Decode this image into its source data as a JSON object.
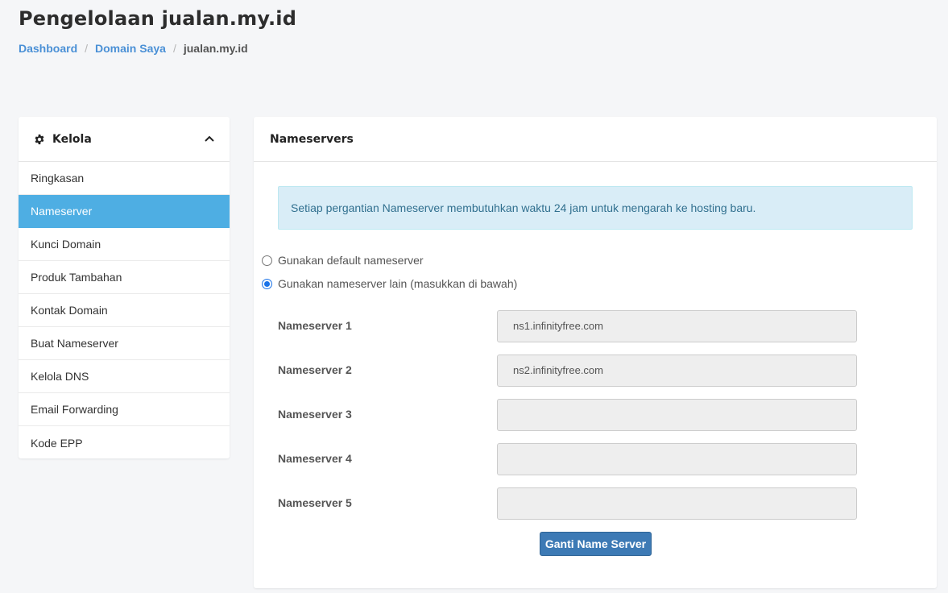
{
  "page": {
    "title": "Pengelolaan jualan.my.id"
  },
  "breadcrumb": [
    {
      "label": "Dashboard"
    },
    {
      "label": "Domain Saya"
    },
    {
      "label": "jualan.my.id"
    }
  ],
  "sidebar": {
    "title": "Kelola",
    "icon": "gear-icon",
    "collapse_icon": "chevron-up-icon",
    "items": [
      {
        "label": "Ringkasan",
        "active": false
      },
      {
        "label": "Nameserver",
        "active": true
      },
      {
        "label": "Kunci Domain",
        "active": false
      },
      {
        "label": "Produk Tambahan",
        "active": false
      },
      {
        "label": "Kontak Domain",
        "active": false
      },
      {
        "label": "Buat Nameserver",
        "active": false
      },
      {
        "label": "Kelola DNS",
        "active": false
      },
      {
        "label": "Email Forwarding",
        "active": false
      },
      {
        "label": "Kode EPP",
        "active": false
      }
    ],
    "active_color": "#4eaee3"
  },
  "panel": {
    "title": "Nameservers",
    "alert": "Setiap pergantian Nameserver membutuhkan waktu 24 jam untuk mengarah ke hosting baru.",
    "options": [
      {
        "label": "Gunakan default nameserver",
        "checked": false
      },
      {
        "label": "Gunakan nameserver lain (masukkan di bawah)",
        "checked": true
      }
    ],
    "nameservers": [
      {
        "label": "Nameserver 1",
        "value": "ns1.infinityfree.com"
      },
      {
        "label": "Nameserver 2",
        "value": "ns2.infinityfree.com"
      },
      {
        "label": "Nameserver 3",
        "value": ""
      },
      {
        "label": "Nameserver 4",
        "value": ""
      },
      {
        "label": "Nameserver 5",
        "value": ""
      }
    ],
    "submit_label": "Ganti Name Server"
  }
}
